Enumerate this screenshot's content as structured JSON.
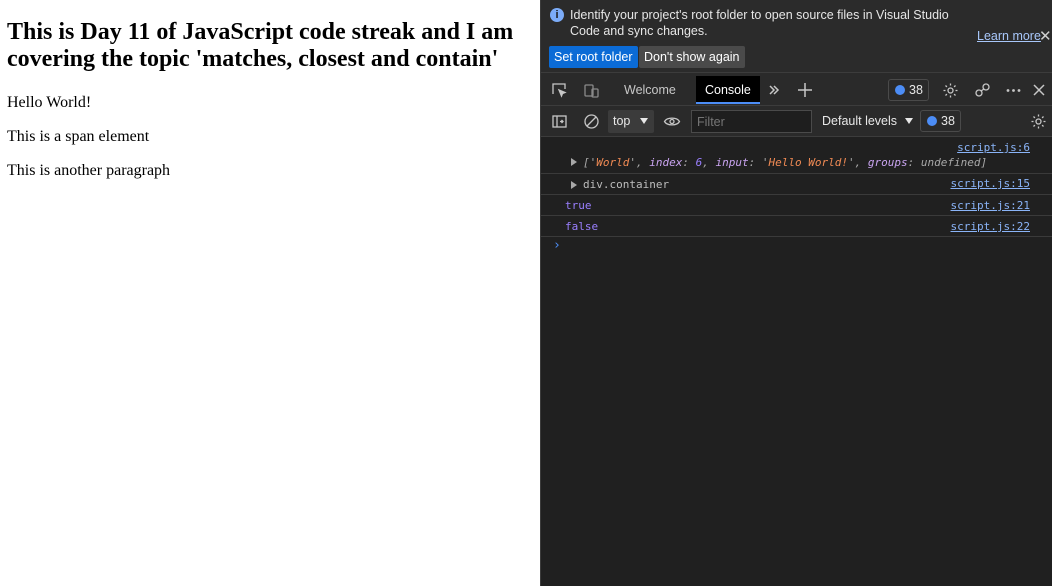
{
  "page": {
    "heading": "This is Day 11 of JavaScript code streak and I am covering the topic 'matches, closest and contain'",
    "paragraphs": [
      "Hello World!",
      "This is a span element",
      "This is another paragraph"
    ]
  },
  "devtools": {
    "infobar": {
      "icon": "info-icon",
      "message": "Identify your project's root folder to open source files in Visual Studio Code and sync changes.",
      "learn_more": "Learn more",
      "set_root_button": "Set root folder",
      "dont_show_button": "Don't show again"
    },
    "tabs": {
      "welcome": "Welcome",
      "console": "Console",
      "issues_count": "38"
    },
    "filter": {
      "context": "top",
      "placeholder": "Filter",
      "levels": "Default levels",
      "issues_count": "38"
    },
    "console": {
      "messages": [
        {
          "source": "script.js:6",
          "parts": {
            "open": "['",
            "str1": "World",
            "sep1": "', ",
            "k1": "index",
            "c1": ": ",
            "n1": "6",
            "sep2": ", ",
            "k2": "input",
            "c2": ": '",
            "str2": "Hello World!",
            "sep3": "', ",
            "k3": "groups",
            "c3": ": ",
            "v3": "undefined",
            "close": "]"
          }
        },
        {
          "text": "div.container",
          "source": "script.js:15"
        },
        {
          "text": "true",
          "source": "script.js:21"
        },
        {
          "text": "false",
          "source": "script.js:22"
        }
      ],
      "prompt": "›"
    },
    "colors": {
      "accent": "#4c8df6",
      "link": "#8ab4f8",
      "primary_button": "#0b6bd6",
      "background": "#202020"
    }
  }
}
